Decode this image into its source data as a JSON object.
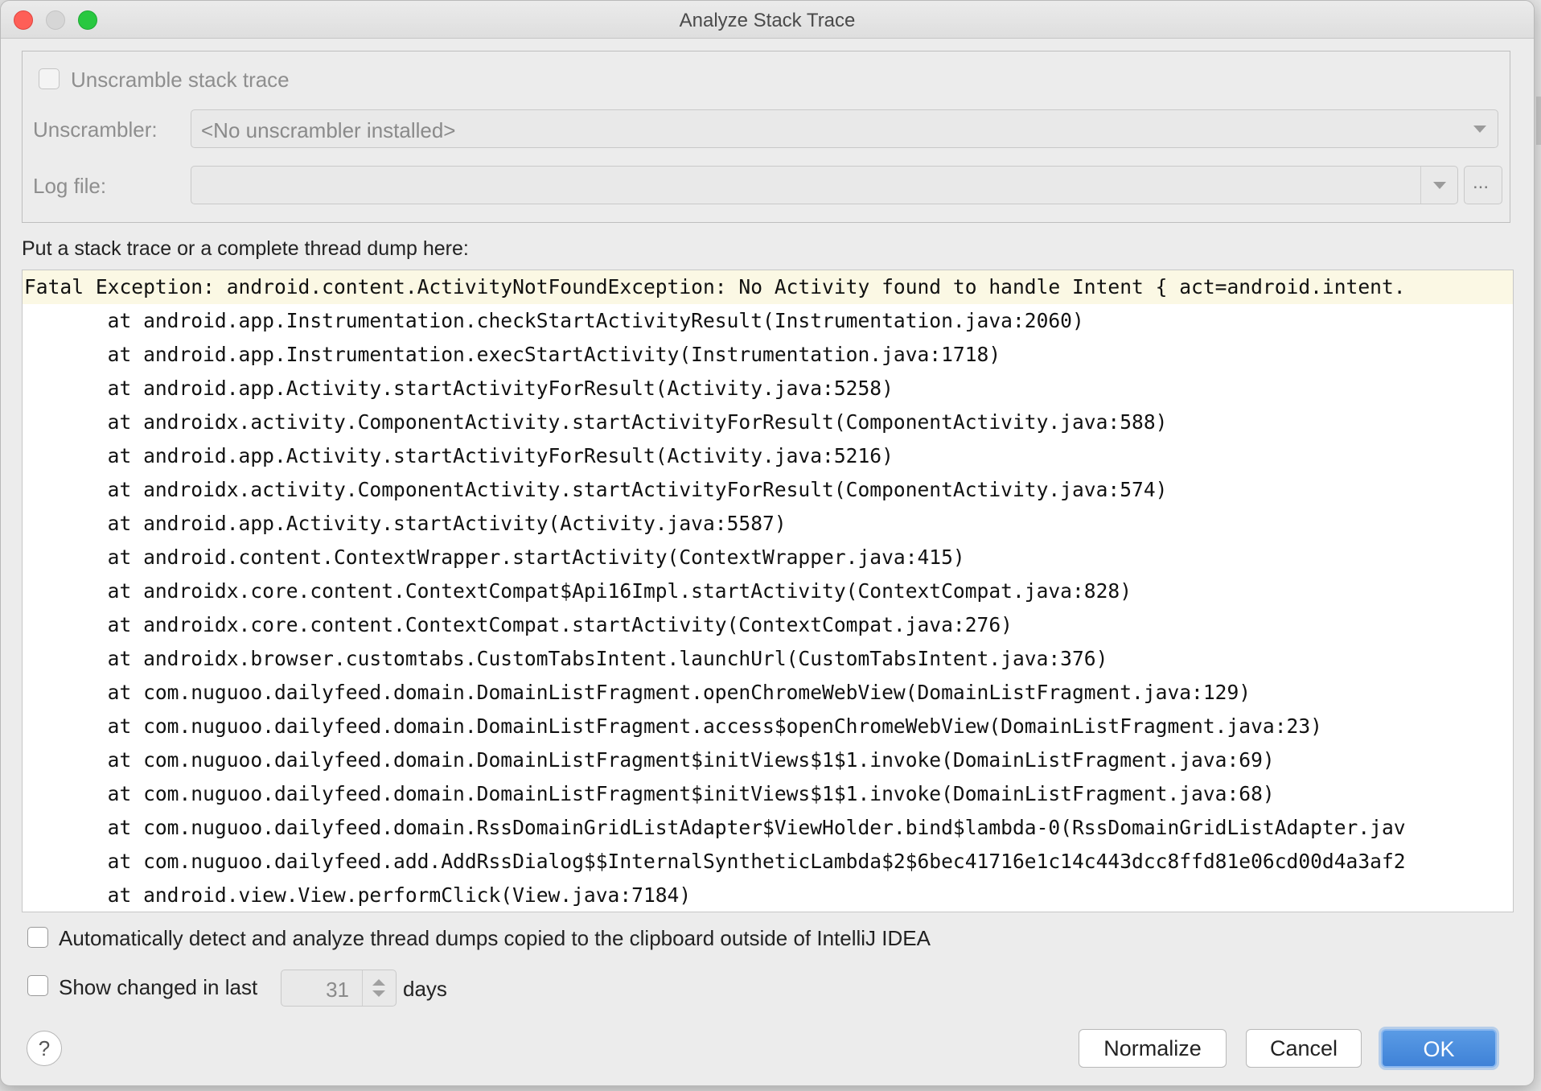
{
  "window": {
    "title": "Analyze Stack Trace"
  },
  "unscramble": {
    "checkbox_label": "Unscramble stack trace",
    "unscrambler_label": "Unscrambler:",
    "unscrambler_value": "<No unscrambler installed>",
    "logfile_label": "Log file:",
    "logfile_value": "",
    "browse_label": "..."
  },
  "trace": {
    "prompt": "Put a stack trace or a complete thread dump here:",
    "lines": [
      "Fatal Exception: android.content.ActivityNotFoundException: No Activity found to handle Intent { act=android.intent.",
      "       at android.app.Instrumentation.checkStartActivityResult(Instrumentation.java:2060)",
      "       at android.app.Instrumentation.execStartActivity(Instrumentation.java:1718)",
      "       at android.app.Activity.startActivityForResult(Activity.java:5258)",
      "       at androidx.activity.ComponentActivity.startActivityForResult(ComponentActivity.java:588)",
      "       at android.app.Activity.startActivityForResult(Activity.java:5216)",
      "       at androidx.activity.ComponentActivity.startActivityForResult(ComponentActivity.java:574)",
      "       at android.app.Activity.startActivity(Activity.java:5587)",
      "       at android.content.ContextWrapper.startActivity(ContextWrapper.java:415)",
      "       at androidx.core.content.ContextCompat$Api16Impl.startActivity(ContextCompat.java:828)",
      "       at androidx.core.content.ContextCompat.startActivity(ContextCompat.java:276)",
      "       at androidx.browser.customtabs.CustomTabsIntent.launchUrl(CustomTabsIntent.java:376)",
      "       at com.nuguoo.dailyfeed.domain.DomainListFragment.openChromeWebView(DomainListFragment.java:129)",
      "       at com.nuguoo.dailyfeed.domain.DomainListFragment.access$openChromeWebView(DomainListFragment.java:23)",
      "       at com.nuguoo.dailyfeed.domain.DomainListFragment$initViews$1$1.invoke(DomainListFragment.java:69)",
      "       at com.nuguoo.dailyfeed.domain.DomainListFragment$initViews$1$1.invoke(DomainListFragment.java:68)",
      "       at com.nuguoo.dailyfeed.domain.RssDomainGridListAdapter$ViewHolder.bind$lambda-0(RssDomainGridListAdapter.jav",
      "       at com.nuguoo.dailyfeed.add.AddRssDialog$$InternalSyntheticLambda$2$6bec41716e1c14c443dcc8ffd81e06cd00d4a3af2",
      "       at android.view.View.performClick(View.java:7184)"
    ]
  },
  "options": {
    "auto_detect_label": "Automatically detect and analyze thread dumps copied to the clipboard outside of IntelliJ IDEA",
    "show_changed_label": "Show changed in last",
    "days_value": "31",
    "days_label": "days"
  },
  "buttons": {
    "help": "?",
    "normalize": "Normalize",
    "cancel": "Cancel",
    "ok": "OK"
  },
  "colors": {
    "primary": "#3f82d7",
    "highlight_line": "#fbf8e4",
    "close": "#fe5f57",
    "maximize": "#28c840"
  }
}
